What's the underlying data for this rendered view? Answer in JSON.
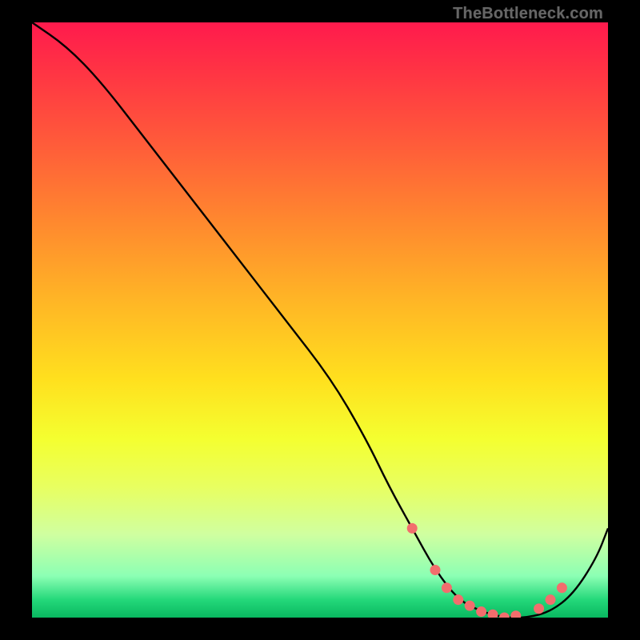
{
  "watermark": "TheBottleneck.com",
  "colors": {
    "frame": "#000000",
    "dot": "#f26d6d",
    "curve": "#000000"
  },
  "chart_data": {
    "type": "line",
    "title": "",
    "xlabel": "",
    "ylabel": "",
    "xlim": [
      0,
      100
    ],
    "ylim": [
      0,
      100
    ],
    "series": [
      {
        "name": "bottleneck-curve",
        "x": [
          0,
          6,
          12,
          20,
          28,
          36,
          44,
          52,
          58,
          62,
          66,
          70,
          74,
          78,
          82,
          86,
          90,
          94,
          98,
          100
        ],
        "y": [
          100,
          96,
          90,
          80,
          70,
          60,
          50,
          40,
          30,
          22,
          15,
          8,
          3,
          1,
          0,
          0,
          1,
          4,
          10,
          15
        ]
      }
    ],
    "markers": {
      "comment": "approximate highlighted points along the valley",
      "x": [
        66,
        70,
        72,
        74,
        76,
        78,
        80,
        82,
        84,
        88,
        90,
        92
      ],
      "y": [
        15,
        8,
        5,
        3,
        2,
        1,
        0.5,
        0,
        0.3,
        1.5,
        3,
        5
      ]
    },
    "gradient_stops": [
      {
        "pos": 0,
        "color": "#ff1a4d"
      },
      {
        "pos": 20,
        "color": "#ff5a3a"
      },
      {
        "pos": 46,
        "color": "#ffb326"
      },
      {
        "pos": 70,
        "color": "#f4ff30"
      },
      {
        "pos": 93,
        "color": "#8cffb4"
      },
      {
        "pos": 100,
        "color": "#09b860"
      }
    ]
  }
}
